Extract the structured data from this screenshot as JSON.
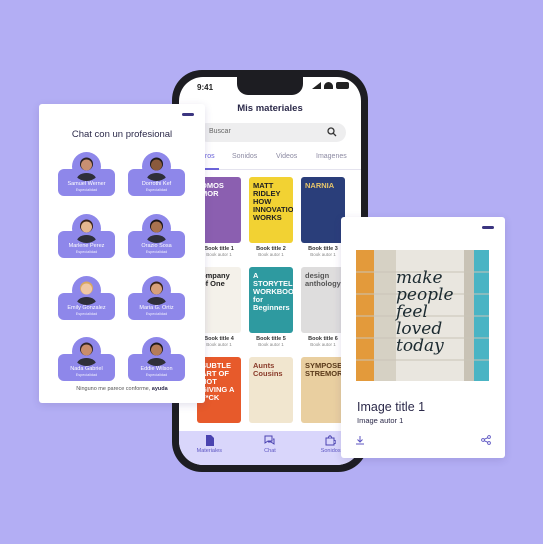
{
  "phone": {
    "status_time": "9:41",
    "title": "Mis materiales",
    "search_placeholder": "Buscar",
    "tabs": [
      "bros",
      "Sonidos",
      "Videos",
      "Imagenes"
    ],
    "books": [
      {
        "cover_text": "OMOS MOR",
        "title": "Book title 1",
        "author": "Book autor 1",
        "color": "#8b5fb0",
        "text_color": "#ffffff"
      },
      {
        "cover_text": "MATT RIDLEY HOW INNOVATION WORKS",
        "title": "Book title 2",
        "author": "Book autor 1",
        "color": "#f2d233",
        "text_color": "#222222"
      },
      {
        "cover_text": "NARNIA",
        "title": "Book title 3",
        "author": "Book autor 1",
        "color": "#2a3e7a",
        "text_color": "#e8c66a"
      },
      {
        "cover_text": "ompany of One",
        "title": "Book title 4",
        "author": "Book autor 1",
        "color": "#f4f1ea",
        "text_color": "#222222"
      },
      {
        "cover_text": "A STORYTELLING WORKBOOK for Beginners",
        "title": "Book title 5",
        "author": "Book autor 1",
        "color": "#2e9aa0",
        "text_color": "#ffffff"
      },
      {
        "cover_text": "design anthology",
        "title": "Book title 6",
        "author": "Book autor 1",
        "color": "#dedddd",
        "text_color": "#555555"
      },
      {
        "cover_text": "SUBTLE ART OF NOT GIVING A F*CK",
        "title": "",
        "author": "",
        "color": "#e75a2b",
        "text_color": "#ffffff"
      },
      {
        "cover_text": "Aunts Cousins",
        "title": "",
        "author": "",
        "color": "#f1e6cf",
        "text_color": "#8a3b2a"
      },
      {
        "cover_text": "SYMPOSE STREMOR",
        "title": "",
        "author": "",
        "color": "#e9cfa0",
        "text_color": "#5a3a1a"
      }
    ],
    "tabbar": [
      "Materiales",
      "Chat",
      "Sonidos"
    ]
  },
  "chat": {
    "title": "Chat con un profesional",
    "professionals": [
      {
        "name": "Samuel Werner",
        "specialty": "Especialidad",
        "skin": "#c99072",
        "hair": "#2b2222"
      },
      {
        "name": "Dorrothi Kef",
        "specialty": "Especialidad",
        "skin": "#8a5a3c",
        "hair": "#1e1a1a"
      },
      {
        "name": "Marlene Perez",
        "specialty": "Especialidad",
        "skin": "#e5b78f",
        "hair": "#3b2418"
      },
      {
        "name": "Orazio Sosa",
        "specialty": "Especialidad",
        "skin": "#a8724f",
        "hair": "#1d1616"
      },
      {
        "name": "Emily Gonzalez",
        "specialty": "Especialidad",
        "skin": "#f0c8a4",
        "hair": "#d9a860"
      },
      {
        "name": "Maria G. Ortiz",
        "specialty": "Especialidad",
        "skin": "#d7a07a",
        "hair": "#3a2418"
      },
      {
        "name": "Nada Gabriel",
        "specialty": "Especialidad",
        "skin": "#c98d6a",
        "hair": "#322626"
      },
      {
        "name": "Eddie Wilson",
        "specialty": "Especialidad",
        "skin": "#b57c58",
        "hair": "#201a1a"
      }
    ],
    "footer_text": "Ninguno me parece conforme,",
    "footer_link": "ayuda"
  },
  "image_card": {
    "photo_text": "make people feel loved today",
    "title": "Image title 1",
    "author": "Image autor 1"
  }
}
